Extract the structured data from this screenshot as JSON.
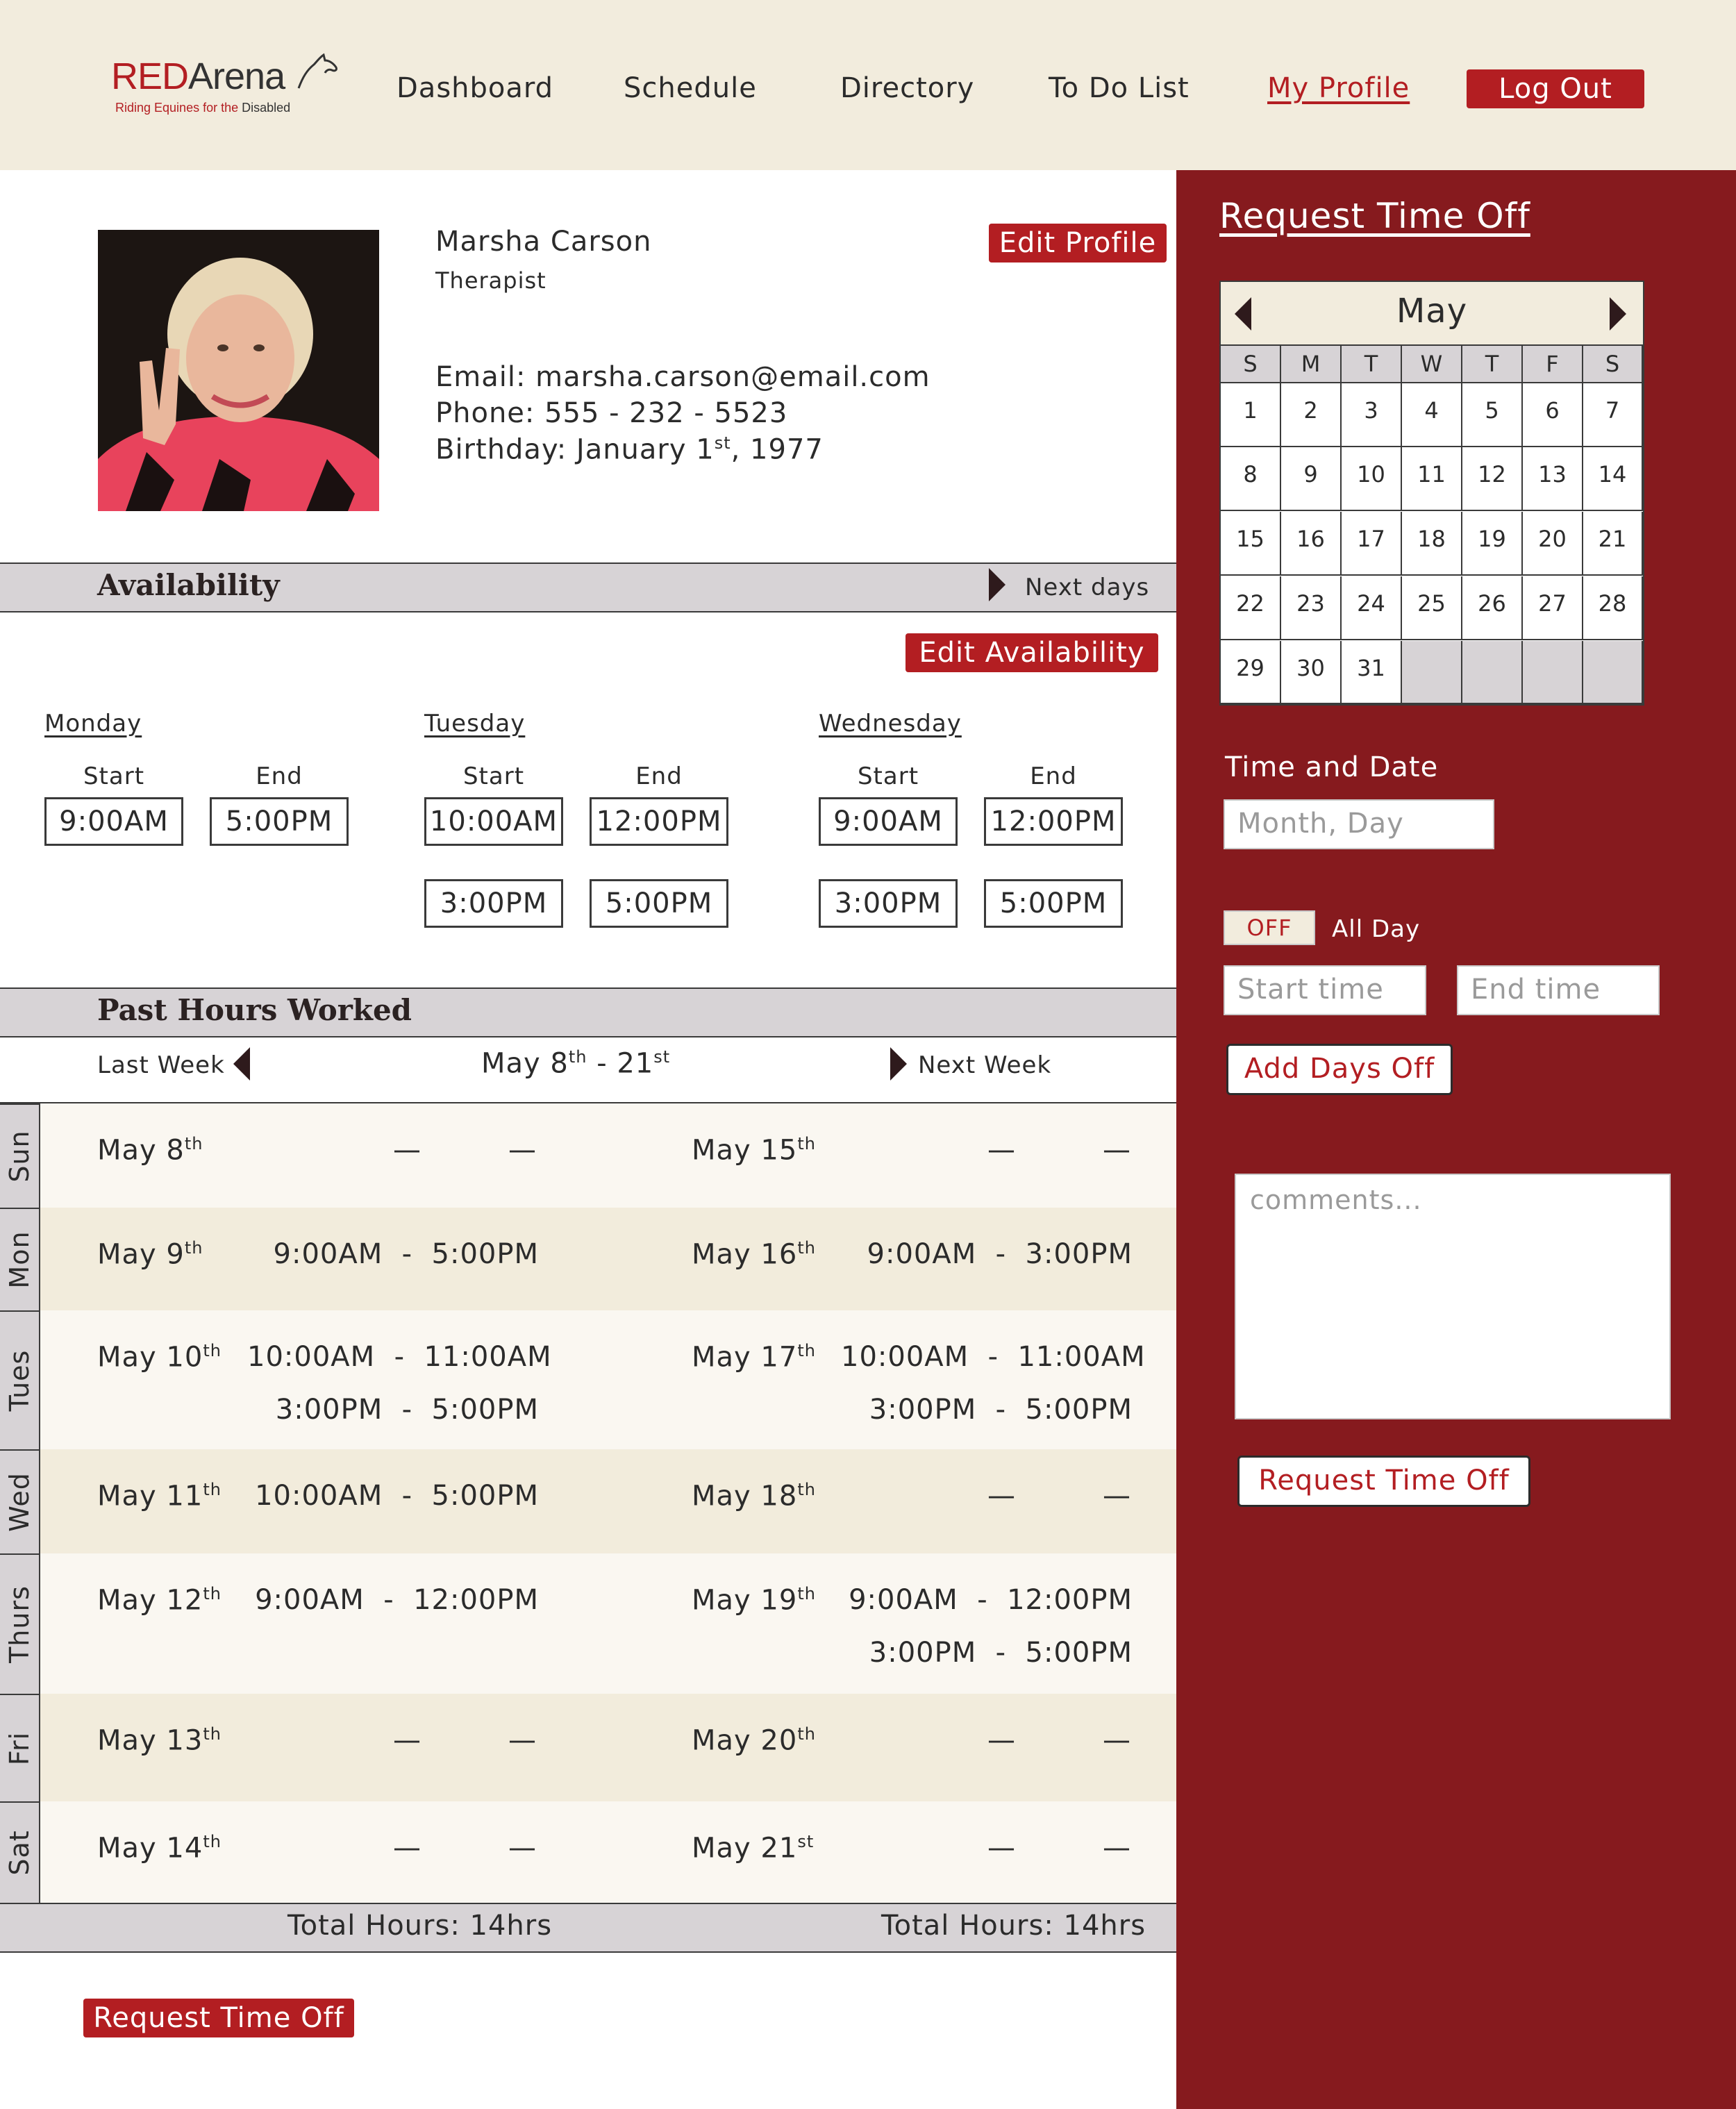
{
  "brand": {
    "name_red": "RED",
    "name_dark": "Arena",
    "tagline_a": "Riding Equines for the ",
    "tagline_b": "Disabled"
  },
  "nav": {
    "items": [
      "Dashboard",
      "Schedule",
      "Directory",
      "To Do List",
      "My Profile"
    ],
    "active": "My Profile",
    "logout": "Log Out"
  },
  "profile": {
    "name": "Marsha Carson",
    "role": "Therapist",
    "edit_label": "Edit Profile",
    "email_line": "Email: marsha.carson@email.com",
    "phone_line": "Phone: 555 - 232 - 5523",
    "birthday_prefix": "Birthday: January 1",
    "birthday_sup": "st",
    "birthday_suffix": ", 1977"
  },
  "availability": {
    "title": "Availability",
    "next_label": "Next days",
    "edit_label": "Edit Availability",
    "start_label": "Start",
    "end_label": "End",
    "days": [
      {
        "name": "Monday",
        "slots": [
          [
            "9:00AM",
            "5:00PM"
          ]
        ]
      },
      {
        "name": "Tuesday",
        "slots": [
          [
            "10:00AM",
            "12:00PM"
          ],
          [
            "3:00PM",
            "5:00PM"
          ]
        ]
      },
      {
        "name": "Wednesday",
        "slots": [
          [
            "9:00AM",
            "12:00PM"
          ],
          [
            "3:00PM",
            "5:00PM"
          ]
        ]
      }
    ]
  },
  "hours": {
    "title": "Past Hours Worked",
    "last_week": "Last Week",
    "next_week": "Next Week",
    "range_a": "May 8",
    "range_a_sup": "th",
    "range_mid": " - 21",
    "range_b_sup": "st",
    "dash": "—",
    "rows": [
      {
        "day": "Sun",
        "d1": "May 8",
        "d1s": "th",
        "w1": [],
        "d2": "May 15",
        "d2s": "th",
        "w2": []
      },
      {
        "day": "Mon",
        "d1": "May 9",
        "d1s": "th",
        "w1": [
          "9:00AM  -  5:00PM"
        ],
        "d2": "May 16",
        "d2s": "th",
        "w2": [
          "9:00AM  -  3:00PM"
        ]
      },
      {
        "day": "Tues",
        "d1": "May 10",
        "d1s": "th",
        "w1": [
          "10:00AM  -  11:00AM",
          "3:00PM  -  5:00PM"
        ],
        "d2": "May 17",
        "d2s": "th",
        "w2": [
          "10:00AM  -  11:00AM",
          "3:00PM  -  5:00PM"
        ]
      },
      {
        "day": "Wed",
        "d1": "May 11",
        "d1s": "th",
        "w1": [
          "10:00AM  -  5:00PM"
        ],
        "d2": "May 18",
        "d2s": "th",
        "w2": []
      },
      {
        "day": "Thurs",
        "d1": "May 12",
        "d1s": "th",
        "w1": [
          "9:00AM  -  12:00PM"
        ],
        "d2": "May 19",
        "d2s": "th",
        "w2": [
          "9:00AM  -  12:00PM",
          "3:00PM  -  5:00PM"
        ]
      },
      {
        "day": "Fri",
        "d1": "May 13",
        "d1s": "th",
        "w1": [],
        "d2": "May 20",
        "d2s": "th",
        "w2": []
      },
      {
        "day": "Sat",
        "d1": "May 14",
        "d1s": "th",
        "w1": [],
        "d2": "May 21",
        "d2s": "st",
        "w2": []
      }
    ],
    "total_1": "Total Hours: 14hrs",
    "total_2": "Total Hours: 14hrs",
    "request_label": "Request Time Off"
  },
  "time_off": {
    "title": "Request Time Off",
    "calendar": {
      "month": "May",
      "dow": [
        "S",
        "M",
        "T",
        "W",
        "T",
        "F",
        "S"
      ],
      "days": [
        "1",
        "2",
        "3",
        "4",
        "5",
        "6",
        "7",
        "8",
        "9",
        "10",
        "11",
        "12",
        "13",
        "14",
        "15",
        "16",
        "17",
        "18",
        "19",
        "20",
        "21",
        "22",
        "23",
        "24",
        "25",
        "26",
        "27",
        "28",
        "29",
        "30",
        "31",
        "",
        "",
        "",
        ""
      ]
    },
    "date_label": "Time and Date",
    "date_placeholder": "Month, Day",
    "toggle_label": "OFF",
    "all_day_label": "All Day",
    "start_placeholder": "Start time",
    "end_placeholder": "End time",
    "add_days_label": "Add Days Off",
    "comments_placeholder": "comments...",
    "submit_label": "Request Time Off"
  },
  "colors": {
    "brand_red": "#b31e22",
    "panel_red": "#861a1e",
    "header_cream": "#f2ecdd",
    "bar_gray": "#d7d3d6"
  }
}
